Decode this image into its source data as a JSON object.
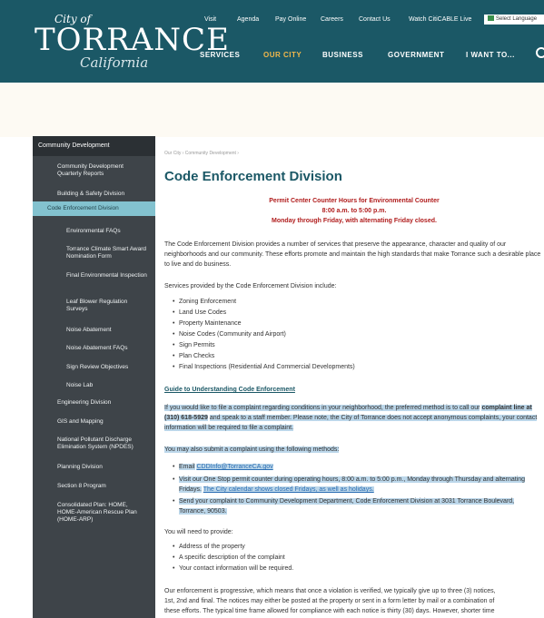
{
  "header": {
    "logo": {
      "city_of": "City of",
      "name": "TORRANCE",
      "state": "California"
    },
    "utility_links": [
      "Visit",
      "Agenda",
      "Pay Online",
      "Careers",
      "Contact Us",
      "Watch CitiCABLE Live"
    ],
    "translate_label": "Select Language",
    "main_nav": [
      "SERVICES",
      "OUR CITY",
      "BUSINESS",
      "GOVERNMENT",
      "I WANT TO..."
    ],
    "active_nav": "OUR CITY"
  },
  "sidebar": {
    "head": "Community Development",
    "items": [
      "Community Development Quarterly Reports",
      "Building & Safety Division",
      "Code Enforcement Division",
      "Environmental FAQs",
      "Torrance Climate Smart Award Nomination Form",
      "Final Environmental Inspection",
      "Leaf Blower Regulation Surveys",
      "Noise Abatement",
      "Noise Abatement FAQs",
      "Sign Review Objectives",
      "Noise Lab",
      "Engineering Division",
      "GIS and Mapping",
      "National Pollutant Discharge Elimination System (NPDES)",
      "Planning Division",
      "Section 8 Program",
      "Consolidated Plan: HOME, HOME-American Rescue Plan (HOME-ARP)"
    ]
  },
  "main": {
    "breadcrumb": "Our City › Community Development ›",
    "title": "Code Enforcement Division",
    "hours": [
      "Permit Center Counter Hours for Environmental Counter",
      "8:00 a.m. to 5:00 p.m.",
      "Monday through Friday, with alternating Friday closed."
    ],
    "intro": "The Code Enforcement Division provides a number of services that preserve the appearance, character and quality of our neighborhoods and our community. These efforts promote and maintain the high standards that make Torrance such a desirable place to live and do business.",
    "services_intro": "Services provided by the Code Enforcement Division include:",
    "services": [
      "Zoning Enforcement",
      "Land Use Codes",
      "Property Maintenance",
      "Noise Codes (Community and Airport)",
      "Sign Permits",
      "Plan Checks",
      "Final Inspections (Residential And Commercial Developments)"
    ],
    "guide_link": "Guide to Understanding Code Enforcement",
    "complaint_p1": "If you would like to file a complaint regarding conditions in your neighborhood, the preferred method is to call our",
    "complaint_line": "complaint line at (310) 618-5929",
    "complaint_p2": "and speak to a staff member.  Please note, the City of Torrance does not accept anonymous complaints, your contact information will be required to file a complaint.",
    "methods_intro": "You may also submit a complaint using the following methods:",
    "method_email_label": "Email",
    "method_email": "CDDInfo@TorranceCA.gov",
    "method_visit": "Visit our One Stop permit counter during operating hours, 8:00 a.m. to 5:00 p.m., Monday through Thursday and alternating Fridays.",
    "method_visit_link": "The City calendar shows closed Fridays, as well as holidays.",
    "method_send": "Send your complaint to Community Development Department, Code Enforcement Division at 3031 Torrance Boulevard, Torrance, 90503.",
    "provide_intro": "You will need to provide:",
    "provide": [
      "Address of the property",
      "A specific description of the complaint",
      "Your contact information will be required."
    ],
    "progressive_a": "Our enforcement is progressive, which means that once a violation is verified, we typically give up to three (3) notices,",
    "progressive_b": "1st, 2nd and final. The notices may either be posted at the property or sent in a form letter by mail or a combination of",
    "progressive_c": "these efforts. The typical time frame allowed for compliance with each notice is thirty (30) days. However, shorter time"
  }
}
